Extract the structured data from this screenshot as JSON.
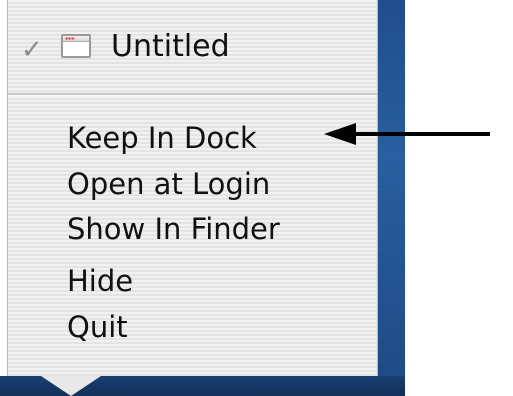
{
  "menu": {
    "current_window": {
      "checked": true,
      "check_glyph": "✓",
      "icon": "window-icon",
      "label": "Untitled"
    },
    "items": [
      {
        "label": "Keep In Dock"
      },
      {
        "label": "Open at Login"
      },
      {
        "label": "Show In Finder"
      },
      {
        "label": "Hide"
      },
      {
        "label": "Quit"
      }
    ]
  },
  "colors": {
    "menu_background": "#ececec",
    "desktop_blue": "#1f4e8c",
    "text": "#111111",
    "arrow": "#000000"
  }
}
